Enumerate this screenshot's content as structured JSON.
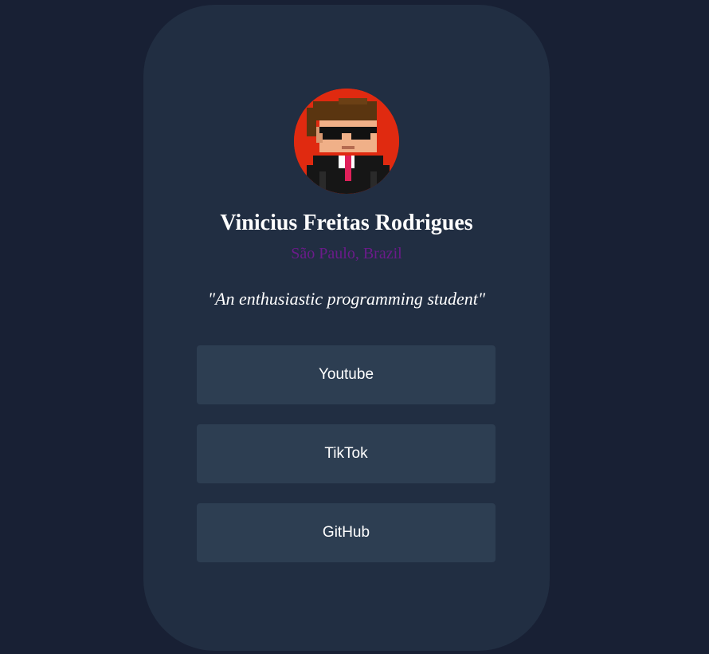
{
  "profile": {
    "avatar_alt": "pixel-art avatar",
    "name": "Vinicius Freitas Rodrigues",
    "location": "São Paulo, Brazil",
    "bio": "\"An enthusiastic programming student\""
  },
  "links": [
    {
      "label": "Youtube"
    },
    {
      "label": "TikTok"
    },
    {
      "label": "GitHub"
    }
  ],
  "colors": {
    "page_background": "#182034",
    "card_background": "#212e42",
    "button_background": "#2d3e52",
    "location_text": "#6b1b8a",
    "avatar_background": "#e02a10"
  }
}
